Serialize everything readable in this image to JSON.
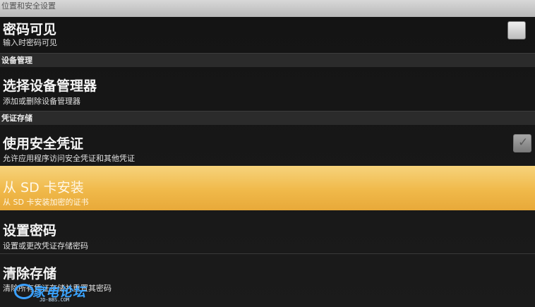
{
  "header": {
    "title": "位置和安全设置"
  },
  "sections": {
    "device_admin": "设备管理",
    "credential_storage": "凭证存储"
  },
  "rows": {
    "visible_password": {
      "title": "密码可见",
      "subtitle": "输入时密码可见",
      "checked": false
    },
    "select_device_admins": {
      "title": "选择设备管理器",
      "subtitle": "添加或删除设备管理器"
    },
    "use_secure_credentials": {
      "title": "使用安全凭证",
      "subtitle": "允许应用程序访问安全凭证和其他凭证",
      "checked": true,
      "enabled": false
    },
    "install_from_sd": {
      "title": "从 SD 卡安装",
      "subtitle": "从 SD 卡安装加密的证书",
      "highlighted": true
    },
    "set_password": {
      "title": "设置密码",
      "subtitle": "设置或更改凭证存储密码"
    },
    "clear_storage": {
      "title": "清除存储",
      "subtitle": "清除所有凭证存储并重置其密码"
    }
  },
  "icons": {
    "checkbox_mark": "✓"
  },
  "watermark": {
    "text": "家电论坛",
    "url_text": "JD-BBS.COM"
  },
  "colors": {
    "highlight": "#f0b94a",
    "watermark": "#39a3ff"
  }
}
